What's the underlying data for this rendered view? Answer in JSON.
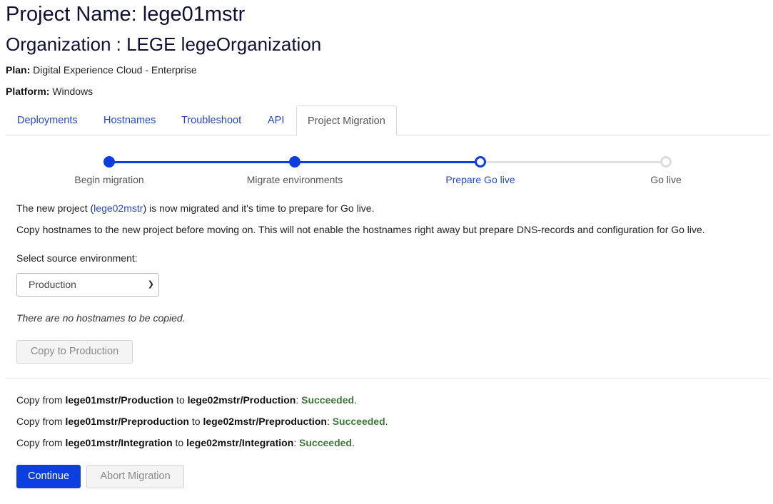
{
  "header": {
    "project_title": "Project Name: lege01mstr",
    "organization_title": "Organization : LEGE legeOrganization",
    "plan_label": "Plan:",
    "plan_value": "Digital Experience Cloud - Enterprise",
    "platform_label": "Platform:",
    "platform_value": "Windows"
  },
  "tabs": [
    {
      "label": "Deployments"
    },
    {
      "label": "Hostnames"
    },
    {
      "label": "Troubleshoot"
    },
    {
      "label": "API"
    },
    {
      "label": "Project Migration",
      "active": true
    }
  ],
  "stepper": {
    "steps": [
      {
        "label": "Begin migration",
        "state": "done"
      },
      {
        "label": "Migrate environments",
        "state": "done"
      },
      {
        "label": "Prepare Go live",
        "state": "current"
      },
      {
        "label": "Go live",
        "state": "todo"
      }
    ]
  },
  "body": {
    "intro_prefix": "The new project (",
    "intro_link": "lege02mstr",
    "intro_suffix": ") is now migrated and it's time to prepare for Go live.",
    "copy_hint": "Copy hostnames to the new project before moving on. This will not enable the hostnames right away but prepare DNS-records and configuration for Go live.",
    "select_label": "Select source environment:",
    "select_value": "Production",
    "empty_message": "There are no hostnames to be copied.",
    "copy_button": "Copy to Production"
  },
  "log": [
    {
      "prefix": "Copy from ",
      "source": "lege01mstr/Production",
      "mid": " to ",
      "target": "lege02mstr/Production",
      "sep": ": ",
      "status": "Succeeded",
      "end": "."
    },
    {
      "prefix": "Copy from ",
      "source": "lege01mstr/Preproduction",
      "mid": " to ",
      "target": "lege02mstr/Preproduction",
      "sep": ": ",
      "status": "Succeeded",
      "end": "."
    },
    {
      "prefix": "Copy from ",
      "source": "lege01mstr/Integration",
      "mid": " to ",
      "target": "lege02mstr/Integration",
      "sep": ": ",
      "status": "Succeeded",
      "end": "."
    }
  ],
  "actions": {
    "continue": "Continue",
    "abort": "Abort Migration"
  },
  "colors": {
    "accent": "#0d3fe0",
    "link": "#2347c8",
    "success": "#3a7a35"
  }
}
